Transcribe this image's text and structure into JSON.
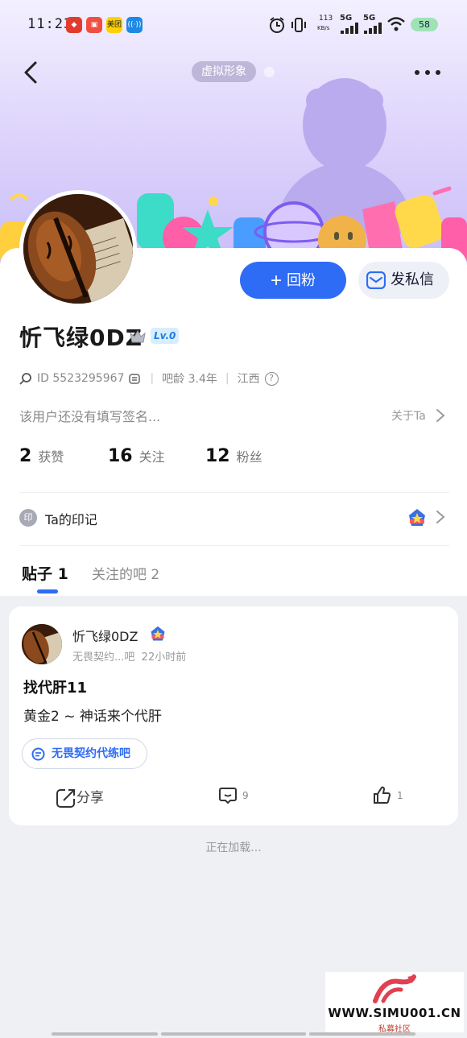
{
  "status_bar": {
    "time": "11:23",
    "speed": "113",
    "speed_unit": "KB/s",
    "net1": "5G",
    "net2": "5G",
    "battery": "58",
    "app_icon_meituan": "美团"
  },
  "header": {
    "avatar_tag": "虚拟形象"
  },
  "profile": {
    "username": "忻飞绿0DZ",
    "level": "Lv.0",
    "id": "ID 5523295967",
    "tieba_age": "吧龄 3.4年",
    "location": "江西",
    "signature": "该用户还没有填写签名...",
    "about_label": "关于Ta",
    "follow_button": "回粉",
    "message_button": "发私信",
    "stats": [
      {
        "num": "2",
        "label": "获赞"
      },
      {
        "num": "16",
        "label": "关注"
      },
      {
        "num": "12",
        "label": "粉丝"
      }
    ],
    "badge_icon_text": "印",
    "badge_label": "Ta的印记"
  },
  "tabs": [
    {
      "label": "贴子 1"
    },
    {
      "label": "关注的吧 2"
    }
  ],
  "post": {
    "author": "忻飞绿0DZ",
    "forum_short": "无畏契约...吧",
    "time": "22小时前",
    "title": "找代肝11",
    "body": "黄金2 ~ 神话来个代肝",
    "forum_tag": "无畏契约代练吧",
    "share_label": "分享",
    "comments": "9",
    "likes": "1"
  },
  "loading_text": "正在加载...",
  "watermark": {
    "url": "WWW.SIMU001.CN",
    "sub": "私募社区"
  },
  "colors": {
    "accent": "#2f6cf5",
    "hero_top": "#f3f0ff",
    "hero_bottom": "#c9bdf7"
  }
}
